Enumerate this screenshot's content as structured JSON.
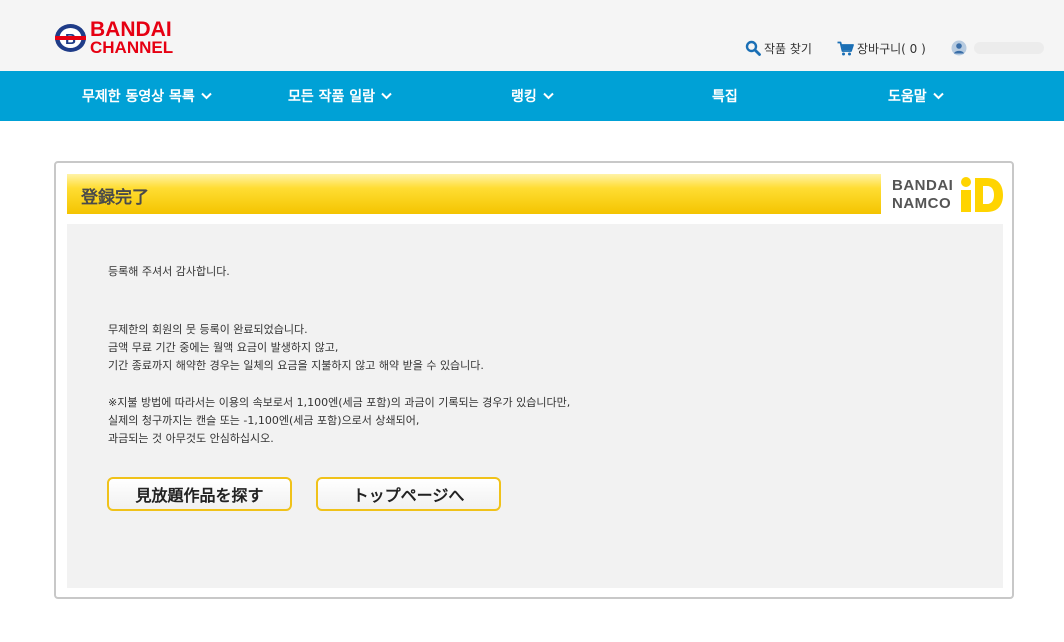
{
  "header": {
    "logo_line1": "BANDAI",
    "logo_line2": "CHANNEL",
    "search_label": "작품 찾기",
    "cart_label": "장바구니( 0 )"
  },
  "nav": {
    "items": [
      {
        "label": "무제한 동영상 목록"
      },
      {
        "label": "모든 작품 일람"
      },
      {
        "label": "랭킹"
      },
      {
        "label": "특집"
      },
      {
        "label": "도움말"
      }
    ]
  },
  "panel": {
    "title": "登録完了",
    "brand_line1": "BANDAI",
    "brand_line2": "NAMCO",
    "messages": {
      "thanks": "등록해 주셔서 감사합니다.",
      "p1_l1": "무제한의 회원의 뭇 등록이 완료되었습니다.",
      "p1_l2": "금액 무료 기간 중에는 월액 요금이 발생하지 않고,",
      "p1_l3": "기간 종료까지 해약한 경우는 일체의 요금을 지불하지 않고 해약 받을 수 있습니다.",
      "p2_l1": "※지불 방법에 따라서는 이용의 속보로서 1,100엔(세금 포함)의 과금이 기록되는 경우가 있습니다만,",
      "p2_l2": "실제의 청구까지는 캔슬 또는 -1,100엔(세금 포함)으로서 상쇄되어,",
      "p2_l3": "과금되는 것 아무것도 안심하십시오."
    },
    "buttons": {
      "search_works": "見放題作品を探す",
      "top_page": "トップページへ"
    }
  },
  "colors": {
    "nav_bg": "#00a1d6",
    "brand_red": "#e60012",
    "title_yellow": "#ffd700",
    "button_border": "#f0c21a"
  }
}
